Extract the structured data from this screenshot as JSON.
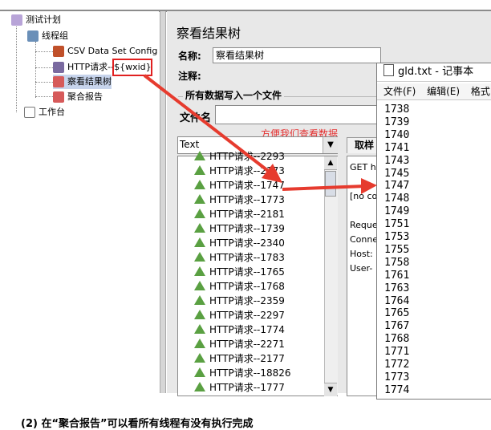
{
  "tree": {
    "items": [
      {
        "label": "测试计划"
      },
      {
        "label": "线程组"
      },
      {
        "label": "CSV Data Set Config"
      },
      {
        "label": "HTTP请求--"
      },
      {
        "label": "察看结果树"
      },
      {
        "label": "聚合报告"
      },
      {
        "label": "工作台"
      }
    ],
    "http_var": "${wxid}"
  },
  "panel": {
    "title": "察看结果树",
    "name_label": "名称:",
    "name_value": "察看结果树",
    "comment_label": "注释:",
    "section_title": "所有数据写入一个文件",
    "filename_label": "文件名"
  },
  "annotation": "方便我们查看数据",
  "list": {
    "combo_value": "Text",
    "items": [
      "HTTP请求--2293",
      "HTTP请求--2173",
      "HTTP请求--1747",
      "HTTP请求--1773",
      "HTTP请求--2181",
      "HTTP请求--1739",
      "HTTP请求--2340",
      "HTTP请求--1783",
      "HTTP请求--1765",
      "HTTP请求--1768",
      "HTTP请求--2359",
      "HTTP请求--2297",
      "HTTP请求--1774",
      "HTTP请求--2271",
      "HTTP请求--2177",
      "HTTP请求--18826",
      "HTTP请求--1777"
    ]
  },
  "response": {
    "tab_label": "取样",
    "lines": [
      "GET h",
      "[no co",
      "Reque",
      "Conne",
      "Host:",
      "User-"
    ]
  },
  "notepad": {
    "title": "gld.txt - 记事本",
    "menu": [
      "文件(F)",
      "编辑(E)",
      "格式"
    ],
    "lines": [
      "1738",
      "1739",
      "1740",
      "1741",
      "1743",
      "1745",
      "1747",
      "1748",
      "1749",
      "1751",
      "1753",
      "1755",
      "1758",
      "1761",
      "1763",
      "1764",
      "1765",
      "1767",
      "1768",
      "1771",
      "1772",
      "1773",
      "1774"
    ]
  },
  "caption": "(2) 在“聚合报告”可以看所有线程有没有执行完成"
}
